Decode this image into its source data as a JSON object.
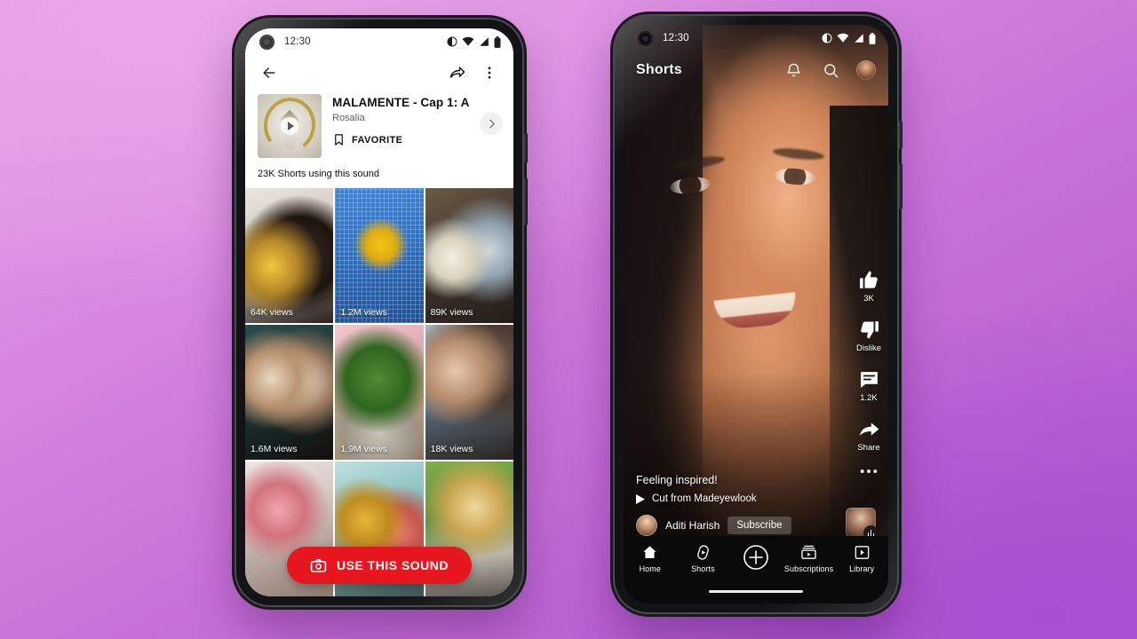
{
  "background": {
    "top_color": "#e4a2e4",
    "bottom_color": "#b055cd"
  },
  "left_phone": {
    "status_bar": {
      "time": "12:30",
      "icons": [
        "alarm-icon",
        "wifi-icon",
        "signal-icon",
        "battery-icon"
      ]
    },
    "top_bar": {
      "back": "back-arrow-icon",
      "share": "share-icon",
      "more": "more-vertical-icon"
    },
    "sound": {
      "title": "MALAMENTE - Cap 1: A...",
      "artist": "Rosalia",
      "favorite_label": "FAVORITE",
      "favorite_icon": "bookmark-icon",
      "chevron_icon": "chevron-right-icon",
      "play_icon": "play-icon",
      "usage_text": "23K Shorts using this sound"
    },
    "grid": [
      {
        "views": "64K views"
      },
      {
        "views": "1.2M views"
      },
      {
        "views": "89K views"
      },
      {
        "views": "1.6M views"
      },
      {
        "views": "1.9M views"
      },
      {
        "views": "18K views"
      },
      {
        "views": ""
      },
      {
        "views": ""
      },
      {
        "views": ""
      }
    ],
    "cta": {
      "label": "USE THIS SOUND",
      "icon": "camera-icon",
      "color": "#e8161f"
    }
  },
  "right_phone": {
    "status_bar": {
      "time": "12:30",
      "icons": [
        "alarm-icon",
        "wifi-icon",
        "signal-icon",
        "battery-icon"
      ]
    },
    "top_bar": {
      "title": "Shorts",
      "bell_icon": "bell-icon",
      "search_icon": "search-icon",
      "avatar": "account-avatar"
    },
    "action_rail": [
      {
        "icon": "thumbs-up-icon",
        "label": "3K"
      },
      {
        "icon": "thumbs-down-icon",
        "label": "Dislike"
      },
      {
        "icon": "comment-icon",
        "label": "1.2K"
      },
      {
        "icon": "share-arrow-icon",
        "label": "Share"
      },
      {
        "icon": "more-horizontal-icon",
        "label": ""
      }
    ],
    "overlay": {
      "caption": "Feeling inspired!",
      "sound_icon": "play-small-icon",
      "sound_text": "Cut from Madeyewlook",
      "channel_name": "Aditi Harish",
      "subscribe_label": "Subscribe",
      "sound_badge_icon": "audio-wave-icon"
    },
    "nav": [
      {
        "icon": "home-icon",
        "label": "Home"
      },
      {
        "icon": "shorts-icon",
        "label": "Shorts"
      },
      {
        "icon": "create-plus-icon",
        "label": ""
      },
      {
        "icon": "subscriptions-icon",
        "label": "Subscriptions"
      },
      {
        "icon": "library-icon",
        "label": "Library"
      }
    ]
  }
}
